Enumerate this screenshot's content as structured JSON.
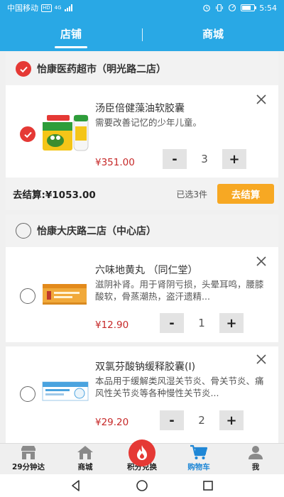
{
  "status_bar": {
    "carrier": "中国移动",
    "hd_badge": "HD",
    "network": "4G",
    "battery_text": "",
    "time": "5:54"
  },
  "top_tabs": [
    {
      "label": "店铺",
      "active": true
    },
    {
      "label": "商城",
      "active": false
    }
  ],
  "stores": [
    {
      "name": "怡康医药超市（明光路二店）",
      "checked": true,
      "products": [
        {
          "name": "汤臣倍健藻油软胶囊",
          "desc": "需要改善记忆的少年儿童。",
          "price": "¥351.00",
          "qty": "3",
          "checked": true
        }
      ],
      "checkout": {
        "label": "去结算:¥1053.00",
        "selected": "已选3件",
        "button": "去结算"
      }
    },
    {
      "name": "怡康大庆路二店（中心店）",
      "checked": false,
      "products": [
        {
          "name": "六味地黄丸 （同仁堂）",
          "desc": "滋阴补肾。用于肾阴亏损，头晕耳鸣，腰膝酸软，骨蒸潮热，盗汗遗精...",
          "price": "¥12.90",
          "qty": "1",
          "checked": false
        },
        {
          "name": "双氯芬酸钠缓释胶囊(I)",
          "desc": "本品用于缓解类风湿关节炎、骨关节炎、痛风性关节炎等各种慢性关节炎...",
          "price": "¥29.20",
          "qty": "2",
          "checked": false
        }
      ]
    }
  ],
  "stepper": {
    "minus": "-",
    "plus": "+"
  },
  "bottom_nav": [
    {
      "label": "29分钟达",
      "icon": "store-icon",
      "active": false
    },
    {
      "label": "商城",
      "icon": "home-icon",
      "active": false
    },
    {
      "label": "积分兑换",
      "icon": "fire-icon",
      "active": false
    },
    {
      "label": "购物车",
      "icon": "cart-icon",
      "active": true
    },
    {
      "label": "我",
      "icon": "person-icon",
      "active": false
    }
  ],
  "colors": {
    "header_blue": "#29a8e5",
    "checked_red": "#e53935",
    "price_red": "#c62828",
    "checkout_orange": "#f7a823",
    "nav_active": "#1f87d6"
  }
}
